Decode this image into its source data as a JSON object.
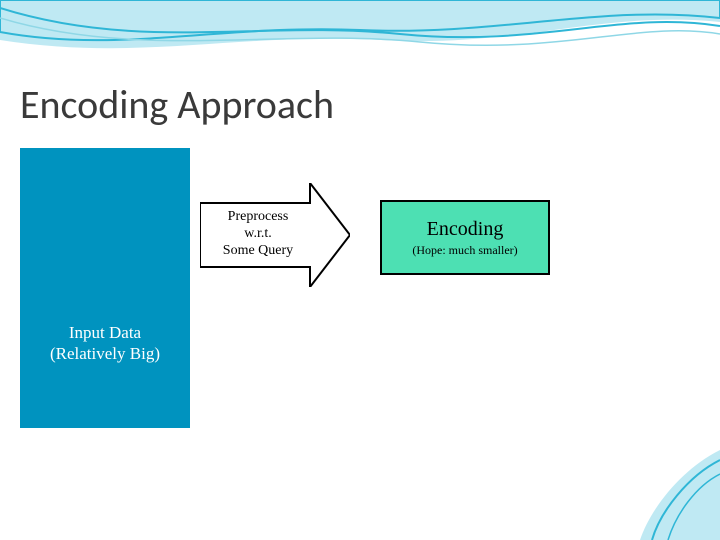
{
  "title": "Encoding Approach",
  "input_box": {
    "line1": "Input Data",
    "line2": "(Relatively Big)"
  },
  "arrow": {
    "line1": "Preprocess",
    "line2": "w.r.t.",
    "line3": "Some Query"
  },
  "encoding_box": {
    "title": "Encoding",
    "subtitle": "(Hope: much smaller)"
  },
  "colors": {
    "input_bg": "#0093bf",
    "encoding_bg": "#4de0b3",
    "wave_primary": "#2fb6d6",
    "wave_light": "#bfe9f3"
  }
}
